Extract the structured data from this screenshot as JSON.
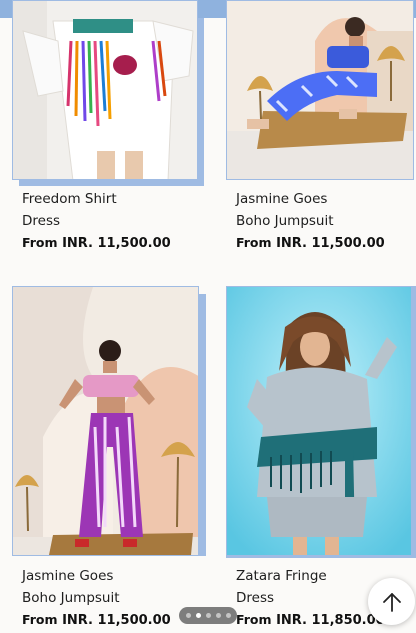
{
  "colors": {
    "accent": "#9fbbe3",
    "topbar": "#8fb2de",
    "background": "#fbfaf8"
  },
  "products": [
    {
      "line1": "Freedom Shirt",
      "line2": "Dress",
      "price_prefix": "From",
      "price": "INR. 11,500.00"
    },
    {
      "line1": "Jasmine Goes",
      "line2": "Boho Jumpsuit",
      "price_prefix": "From",
      "price": "INR. 11,500.00"
    },
    {
      "line1": "Jasmine Goes",
      "line2": "Boho Jumpsuit",
      "price_prefix": "From",
      "price": "INR. 11,500.00"
    },
    {
      "line1": "Zatara Fringe",
      "line2": "Dress",
      "price_prefix": "From",
      "price": "INR. 11,850.00"
    }
  ],
  "pagination": {
    "total": 5,
    "active": 1
  },
  "scroll_top": {
    "icon": "arrow-up-icon"
  }
}
